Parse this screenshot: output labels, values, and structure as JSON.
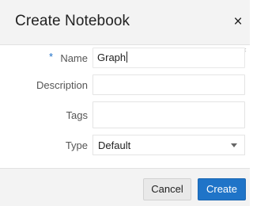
{
  "dialog": {
    "title": "Create Notebook",
    "close_glyph": "×"
  },
  "form": {
    "required_marker": "*",
    "name": {
      "label": "Name",
      "value": "Graph"
    },
    "description": {
      "label": "Description",
      "value": ""
    },
    "tags": {
      "label": "Tags",
      "value": ""
    },
    "type": {
      "label": "Type",
      "selected": "Default"
    }
  },
  "footer": {
    "cancel_label": "Cancel",
    "create_label": "Create"
  },
  "colors": {
    "primary": "#1f74c8",
    "required": "#1a6ec8",
    "header_bg": "#f3f3f3"
  }
}
